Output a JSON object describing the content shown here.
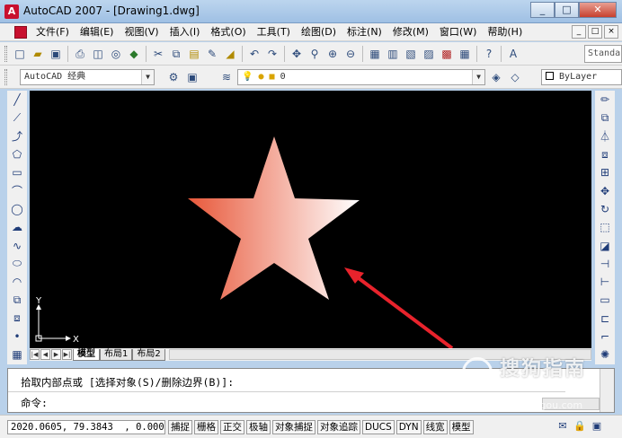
{
  "window": {
    "title": "AutoCAD 2007 - [Drawing1.dwg]",
    "controls": [
      "_",
      "□",
      "✕"
    ]
  },
  "menubar": {
    "items": [
      "文件(F)",
      "编辑(E)",
      "视图(V)",
      "插入(I)",
      "格式(O)",
      "工具(T)",
      "绘图(D)",
      "标注(N)",
      "修改(M)",
      "窗口(W)",
      "帮助(H)"
    ],
    "doc_controls": [
      "_",
      "□",
      "×"
    ]
  },
  "toolbar_standard": {
    "standard_text": "Standa"
  },
  "toolbar_layers": {
    "workspace": "AutoCAD 经典",
    "layer_value": "0",
    "bylayer": "ByLayer"
  },
  "drawing": {
    "ucs_y": "Y",
    "ucs_x": "X",
    "star_gradient": [
      "#e8583a",
      "#ffffff"
    ]
  },
  "tabs": {
    "nav": [
      "|◀",
      "◀",
      "▶",
      "▶|"
    ],
    "items": [
      "模型",
      "布局1",
      "布局2"
    ]
  },
  "command": {
    "line1": "拾取内部点或 [选择对象(S)/删除边界(B)]:",
    "line2": "命令:"
  },
  "status": {
    "coords": "2020.0605, 79.3843  , 0.0000",
    "buttons": [
      "捕捉",
      "栅格",
      "正交",
      "极轴",
      "对象捕捉",
      "对象追踪",
      "DUCS",
      "DYN",
      "线宽",
      "模型"
    ]
  },
  "watermark": {
    "text": "搜狗指南",
    "url": "zhinan.sogou.com"
  }
}
